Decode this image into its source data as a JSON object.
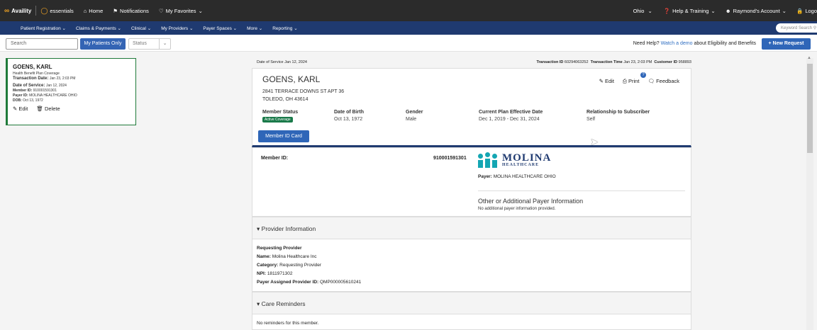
{
  "topbar": {
    "brand": "Availity",
    "essentials": "essentials",
    "home": "Home",
    "notifications": "Notifications",
    "favorites": "My Favorites",
    "state": "Ohio",
    "help": "Help & Training",
    "account": "Raymond's Account",
    "logout": "Logo"
  },
  "nav": {
    "items": [
      "Patient Registration",
      "Claims & Payments",
      "Clinical",
      "My Providers",
      "Payer Spaces",
      "More",
      "Reporting"
    ],
    "keyword": "Keyword Search"
  },
  "search": {
    "placeholder": "Search",
    "my_patients": "My Patients Only",
    "status": "Status",
    "need_help_prefix": "Need Help?",
    "need_help_link": "Watch a demo",
    "need_help_suffix": "about Eligibility and Benefits",
    "new_request": "+ New Request"
  },
  "left_card": {
    "name": "GOENS, KARL",
    "coverage": "Health Benefit Plan Coverage",
    "transaction_label": "Transaction Date:",
    "transaction_value": "Jan 23, 2:03 PM",
    "dos_label": "Date of Service:",
    "dos_value": "Jan 12, 2024",
    "member_label": "Member ID:",
    "member_value": "910001591301",
    "payer_label": "Payer ID:",
    "payer_value": "MOLINA HEALTHCARE OHIO",
    "dob_label": "DOB:",
    "dob_value": "Oct 13, 1972",
    "edit": "Edit",
    "delete": "Delete"
  },
  "meta": {
    "dos": "Date of Service Jan 12, 2024",
    "txn_label": "Transaction ID",
    "txn_id": "60294063252",
    "time_label": "Transaction Time",
    "time": "Jan 23, 2:03 PM",
    "cust_label": "Customer ID",
    "cust_id": "958893"
  },
  "patient": {
    "name": "GOENS, KARL",
    "addr1": "2841 TERRACE DOWNS ST APT 36",
    "addr2": "TOLEDO, OH 43614",
    "edit": "Edit",
    "print": "Print",
    "feedback": "Feedback",
    "help_mark": "?",
    "member_status_h": "Member Status",
    "member_status_v": "Active Coverage",
    "dob_h": "Date of Birth",
    "dob_v": "Oct 13, 1972",
    "gender_h": "Gender",
    "gender_v": "Male",
    "plan_h": "Current Plan Effective Date",
    "plan_v": "Dec 1, 2019 - Dec 31, 2024",
    "rel_h": "Relationship to Subscriber",
    "rel_v": "Self",
    "card_btn": "Member ID Card"
  },
  "member": {
    "label": "Member ID:",
    "id": "910001591301",
    "logo_main": "MOLINA",
    "logo_sub": "HEALTHCARE",
    "payer_label": "Payer:",
    "payer_value": "MOLINA HEALTHCARE OHIO",
    "other": "Other or Additional Payer Information",
    "noadd": "No additional payer information provided."
  },
  "provider": {
    "title": "Provider Information",
    "req": "Requesting Provider",
    "name_label": "Name:",
    "name_value": "Molina Healthcare Inc",
    "cat_label": "Category:",
    "cat_value": "Requesting Provider",
    "npi_label": "NPI:",
    "npi_value": "1811971302",
    "pap_label": "Payer Assigned Provider ID:",
    "pap_value": "QMP000005610241"
  },
  "care": {
    "title": "Care Reminders",
    "none": "No reminders for this member."
  },
  "colors": {
    "nav": "#1f3a70",
    "accent": "#2f66b8",
    "active": "#1a7a4a",
    "brand": "#f5a623"
  }
}
